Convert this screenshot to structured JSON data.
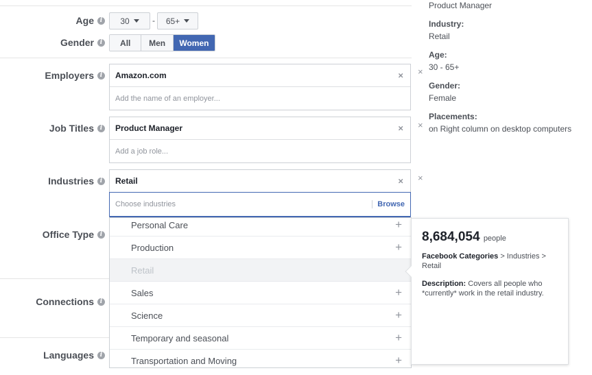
{
  "form": {
    "age": {
      "label": "Age",
      "min": "30",
      "max": "65+",
      "separator": "-"
    },
    "gender": {
      "label": "Gender",
      "options": [
        "All",
        "Men",
        "Women"
      ],
      "selected": "Women"
    },
    "employers": {
      "label": "Employers",
      "value": "Amazon.com",
      "placeholder": "Add the name of an employer..."
    },
    "job_titles": {
      "label": "Job Titles",
      "value": "Product Manager",
      "placeholder": "Add a job role..."
    },
    "industries": {
      "label": "Industries",
      "value": "Retail",
      "placeholder": "Choose industries",
      "browse": "Browse"
    },
    "office_type": {
      "label": "Office Type"
    },
    "connections": {
      "label": "Connections"
    },
    "languages": {
      "label": "Languages"
    },
    "remove_glyph": "×",
    "info_glyph": "i"
  },
  "dropdown": {
    "items": [
      {
        "label": "Personal Care",
        "disabled": false
      },
      {
        "label": "Production",
        "disabled": false
      },
      {
        "label": "Retail",
        "disabled": true
      },
      {
        "label": "Sales",
        "disabled": false
      },
      {
        "label": "Science",
        "disabled": false
      },
      {
        "label": "Temporary and seasonal",
        "disabled": false
      },
      {
        "label": "Transportation and Moving",
        "disabled": false
      }
    ],
    "add_glyph": "+"
  },
  "popup": {
    "count": "8,684,054",
    "count_unit": "people",
    "category_label": "Facebook Categories",
    "category_path": " > Industries > Retail",
    "description_label": "Description:",
    "description": " Covers all people who *currently* work in the retail industry."
  },
  "summary": {
    "job_title_value": "Product Manager",
    "industry_label": "Industry:",
    "industry_value": "Retail",
    "age_label": "Age:",
    "age_value": "30 - 65+",
    "gender_label": "Gender:",
    "gender_value": "Female",
    "placements_label": "Placements:",
    "placements_value": "on Right column on desktop computers"
  },
  "colors": {
    "accent": "#4267b2",
    "border": "#ccd0d5",
    "text": "#4b4f56"
  }
}
